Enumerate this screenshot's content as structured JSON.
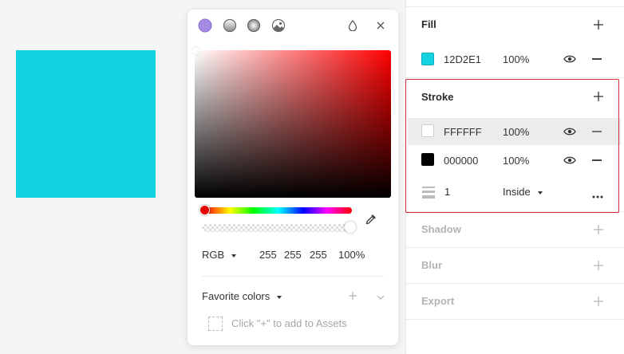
{
  "canvas": {
    "shape_color": "#12D2E1"
  },
  "picker": {
    "modes": [
      "solid-mode",
      "linear-gradient-mode",
      "radial-gradient-mode",
      "image-fill-mode"
    ],
    "accent": "#a48ae4",
    "hue_color": "#ff0000",
    "color_model": "RGB",
    "r": "255",
    "g": "255",
    "b": "255",
    "alpha": "100%",
    "favorite_label": "Favorite colors",
    "assets_hint": "Click \"+\" to add to Assets"
  },
  "panel": {
    "fill": {
      "title": "Fill",
      "items": [
        {
          "hex": "12D2E1",
          "opacity": "100%",
          "color": "#12D2E1"
        }
      ]
    },
    "stroke": {
      "title": "Stroke",
      "items": [
        {
          "hex": "FFFFFF",
          "opacity": "100%",
          "color": "#FFFFFF"
        },
        {
          "hex": "000000",
          "opacity": "100%",
          "color": "#000000"
        }
      ],
      "weight": "1",
      "position": "Inside"
    },
    "shadow_title": "Shadow",
    "blur_title": "Blur",
    "export_title": "Export",
    "highlight_color": "#d32f3a"
  }
}
